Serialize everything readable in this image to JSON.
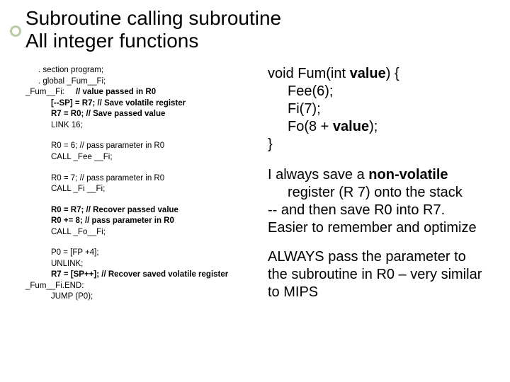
{
  "title_line1": "Subroutine calling subroutine",
  "title_line2": "All integer functions",
  "left": {
    "l1": ". section program;",
    "l2": ". global _Fum__Fi;",
    "l3a": "_Fum__Fi:",
    "l3b": "// value passed in R0",
    "l4": "[--SP] = R7; // Save volatile register",
    "l5": "R7 = R0; // Save passed value",
    "l6": "LINK 16;",
    "l7": "R0 = 6;  // pass parameter in R0",
    "l8": "CALL _Fee __Fi;",
    "l9": "R0 = 7;  // pass parameter in R0",
    "l10": "CALL _Fi __Fi;",
    "l11": "R0 = R7;   // Recover passed value",
    "l12": " R0 += 8;  // pass parameter in R0",
    "l13": "CALL _Fo__Fi;",
    "l14": "P0 = [FP +4];",
    "l15": "UNLINK;",
    "l16": "R7 = [SP++];  // Recover saved volatile register",
    "l17": "_Fum__Fi.END:",
    "l18": "JUMP (P0);"
  },
  "right": {
    "c1": "void Fum(int ",
    "c1b": "value",
    "c1c": ") {",
    "c2": "Fee(6);",
    "c3": "Fi(7);",
    "c4a": "Fo(8 + ",
    "c4b": "value",
    "c4c": ");",
    "c5": "}",
    "p1a": "I always save a ",
    "p1b": "non-volatile",
    "p1c": " register (R 7) onto the stack",
    "p2": "-- and then save R0 into R7. Easier to remember and optimize",
    "p3": "ALWAYS pass the parameter to the subroutine in R0 – very similar to MIPS"
  }
}
